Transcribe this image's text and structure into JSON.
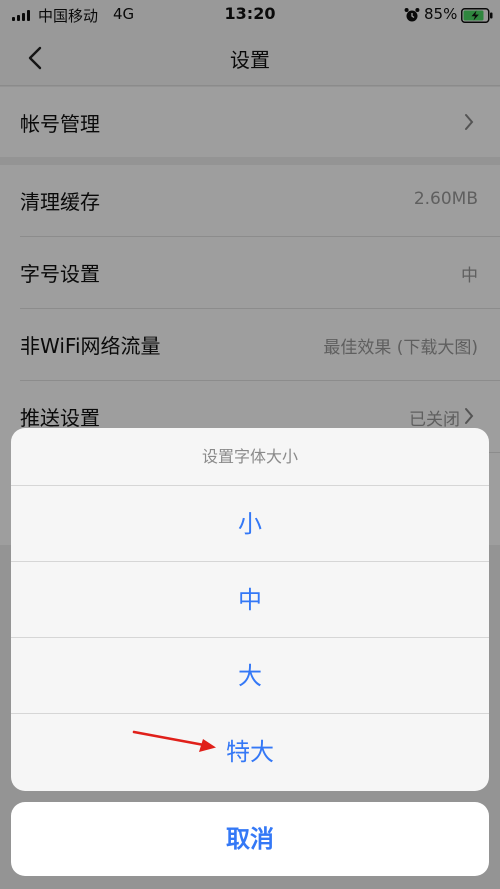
{
  "status_bar": {
    "carrier": "中国移动",
    "network": "4G",
    "time": "13:20",
    "battery_percent": "85%",
    "battery_level": 0.85
  },
  "nav": {
    "title": "设置",
    "back_icon": "chevron-left-icon"
  },
  "settings": {
    "account": {
      "label": "帐号管理"
    },
    "rows": [
      {
        "label": "清理缓存",
        "value": "2.60MB"
      },
      {
        "label": "字号设置",
        "value": "中"
      },
      {
        "label": "非WiFi网络流量",
        "value": "最佳效果 (下载大图)"
      },
      {
        "label": "推送设置",
        "value": "已关闭"
      }
    ]
  },
  "action_sheet": {
    "title": "设置字体大小",
    "options": [
      "小",
      "中",
      "大",
      "特大"
    ],
    "cancel_label": "取消"
  },
  "colors": {
    "accent": "#3478f6",
    "annotation_arrow": "#e0201a",
    "battery_fill": "#4cd964"
  }
}
